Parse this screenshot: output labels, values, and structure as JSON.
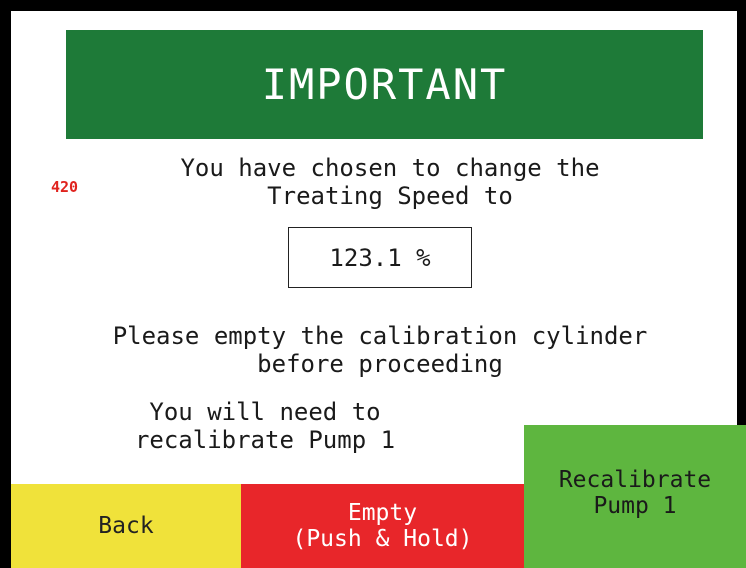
{
  "banner": {
    "title": "IMPORTANT"
  },
  "screen_code": "420",
  "message": {
    "line1": "You have chosen to change the\nTreating Speed to",
    "value": "123.1 %",
    "line2": "Please empty the calibration cylinder\nbefore proceeding",
    "line3": "You will need to\nrecalibrate Pump 1"
  },
  "buttons": {
    "back": "Back",
    "empty": "Empty\n(Push & Hold)",
    "recalibrate": "Recalibrate\nPump 1"
  },
  "colors": {
    "banner_bg": "#1e7a38",
    "back_bg": "#f0e23a",
    "empty_bg": "#e8262a",
    "recal_bg": "#5eb63f",
    "code_color": "#e0231e"
  }
}
